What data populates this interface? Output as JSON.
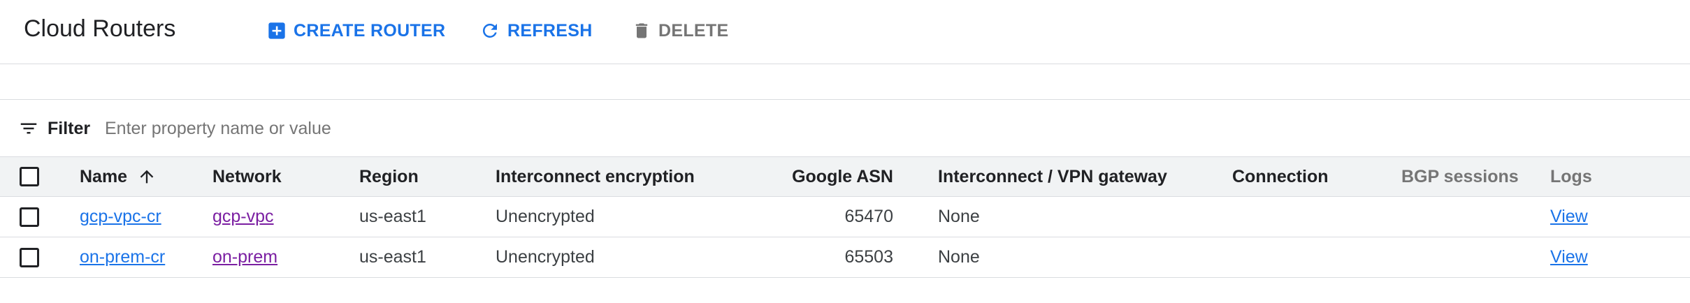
{
  "header": {
    "title": "Cloud Routers",
    "actions": {
      "create": "CREATE ROUTER",
      "refresh": "REFRESH",
      "delete": "DELETE"
    }
  },
  "filter": {
    "label": "Filter",
    "placeholder": "Enter property name or value"
  },
  "table": {
    "columns": {
      "name": "Name",
      "network": "Network",
      "region": "Region",
      "encryption": "Interconnect encryption",
      "asn": "Google ASN",
      "gateway": "Interconnect / VPN gateway",
      "connection": "Connection",
      "bgp": "BGP sessions",
      "logs": "Logs"
    },
    "sort": {
      "column": "Name",
      "direction": "ascending"
    },
    "rows": [
      {
        "name": "gcp-vpc-cr",
        "network": "gcp-vpc",
        "region": "us-east1",
        "encryption": "Unencrypted",
        "asn": "65470",
        "gateway": "None",
        "connection": "",
        "bgp": "",
        "logs": "View"
      },
      {
        "name": "on-prem-cr",
        "network": "on-prem",
        "region": "us-east1",
        "encryption": "Unencrypted",
        "asn": "65503",
        "gateway": "None",
        "connection": "",
        "bgp": "",
        "logs": "View"
      }
    ]
  },
  "colors": {
    "accent": "#1a73e8",
    "network_link": "#7b1fa2",
    "disabled": "#757575",
    "header_bg": "#f1f3f4",
    "border": "#dadce0"
  },
  "icons": {
    "create": "add-box-icon",
    "refresh": "refresh-icon",
    "delete": "trash-icon",
    "filter": "filter-list-icon",
    "sort": "arrow-up-icon"
  }
}
